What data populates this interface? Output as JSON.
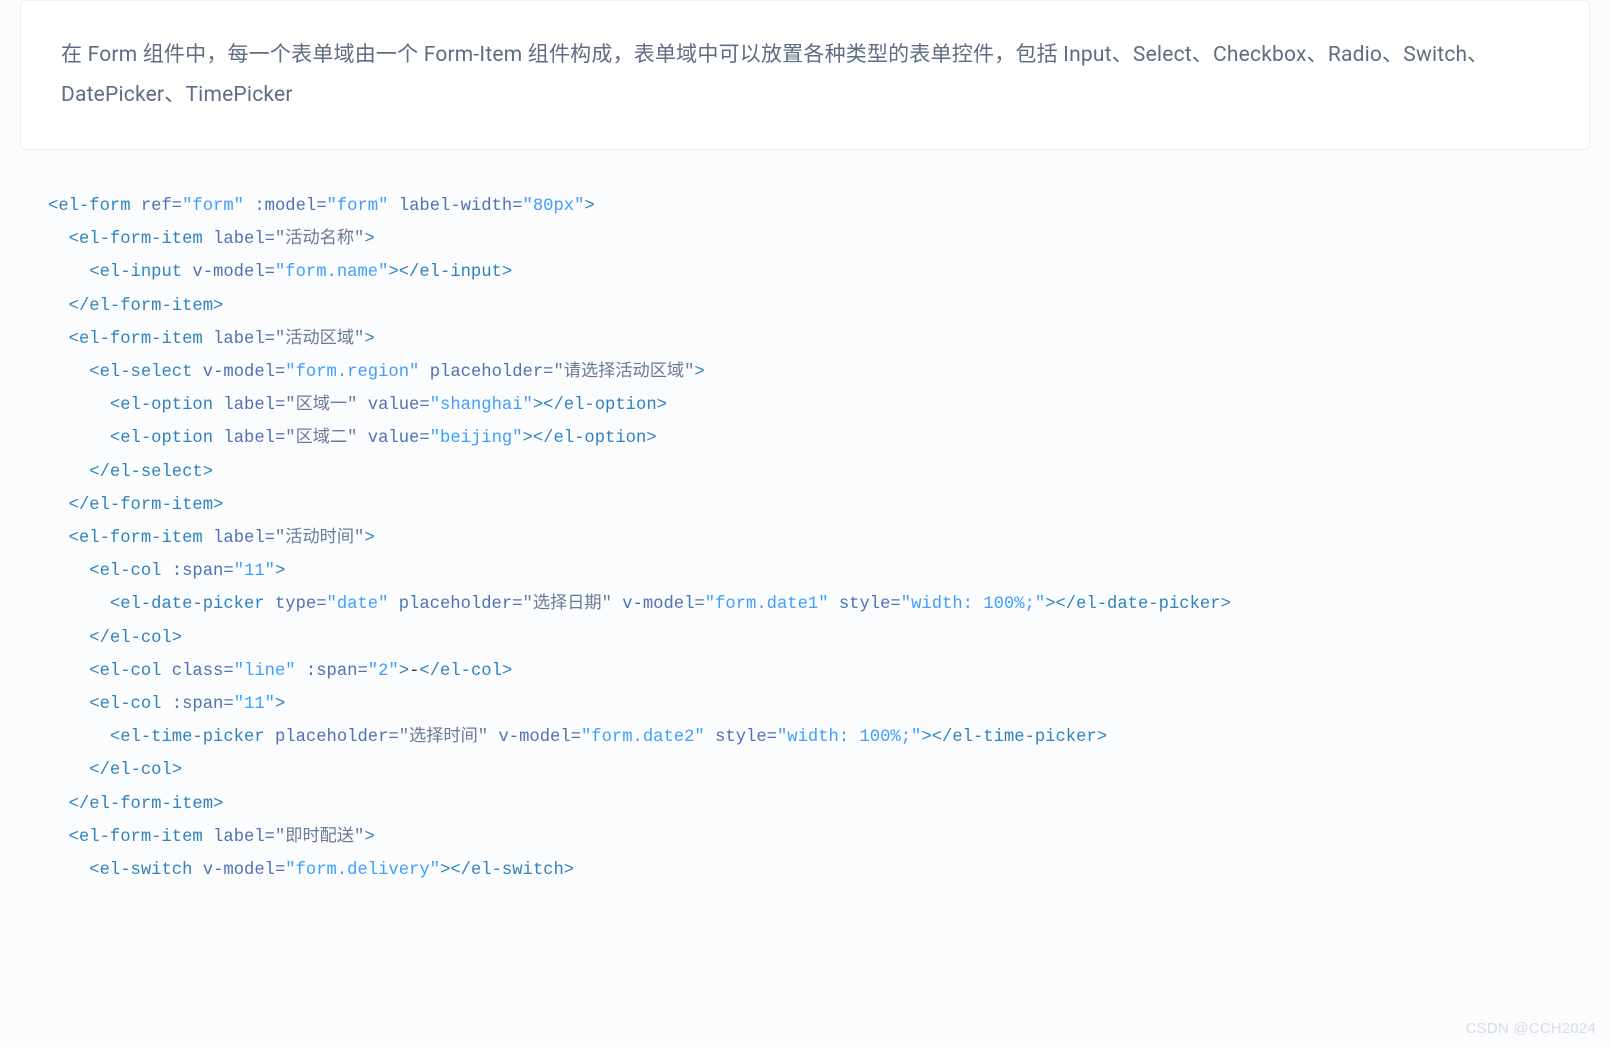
{
  "description": "在 Form 组件中，每一个表单域由一个 Form-Item 组件构成，表单域中可以放置各种类型的表单控件，包括 Input、Select、Checkbox、Radio、Switch、DatePicker、TimePicker",
  "code": {
    "l01": {
      "tag_open": "<el-form",
      "a1": "ref=",
      "v1": "\"form\"",
      "a2": ":model=",
      "v2": "\"form\"",
      "a3": "label-width=",
      "v3": "\"80px\"",
      "close": ">"
    },
    "l02": {
      "tag_open": "<el-form-item",
      "a1": "label=",
      "v1": "\"活动名称\"",
      "close": ">"
    },
    "l03": {
      "tag_open": "<el-input",
      "a1": "v-model=",
      "v1": "\"form.name\"",
      "mid": ">",
      "tag_close": "</el-input>"
    },
    "l04": {
      "tag_close": "</el-form-item>"
    },
    "l05": {
      "tag_open": "<el-form-item",
      "a1": "label=",
      "v1": "\"活动区域\"",
      "close": ">"
    },
    "l06": {
      "tag_open": "<el-select",
      "a1": "v-model=",
      "v1": "\"form.region\"",
      "a2": "placeholder=",
      "v2": "\"请选择活动区域\"",
      "close": ">"
    },
    "l07": {
      "tag_open": "<el-option",
      "a1": "label=",
      "v1": "\"区域一\"",
      "a2": "value=",
      "v2": "\"shanghai\"",
      "mid": ">",
      "tag_close": "</el-option>"
    },
    "l08": {
      "tag_open": "<el-option",
      "a1": "label=",
      "v1": "\"区域二\"",
      "a2": "value=",
      "v2": "\"beijing\"",
      "mid": ">",
      "tag_close": "</el-option>"
    },
    "l09": {
      "tag_close": "</el-select>"
    },
    "l10": {
      "tag_close": "</el-form-item>"
    },
    "l11": {
      "tag_open": "<el-form-item",
      "a1": "label=",
      "v1": "\"活动时间\"",
      "close": ">"
    },
    "l12": {
      "tag_open": "<el-col",
      "a1": ":span=",
      "v1": "\"11\"",
      "close": ">"
    },
    "l13": {
      "tag_open": "<el-date-picker",
      "a1": "type=",
      "v1": "\"date\"",
      "a2": "placeholder=",
      "v2": "\"选择日期\"",
      "a3": "v-model=",
      "v3": "\"form.date1\"",
      "a4": "style=",
      "v4": "\"width: 100%;\"",
      "mid": ">",
      "tag_close": "</el-date-picker>"
    },
    "l14": {
      "tag_close": "</el-col>"
    },
    "l15": {
      "tag_open": "<el-col",
      "a1": "class=",
      "v1": "\"line\"",
      "a2": ":span=",
      "v2": "\"2\"",
      "mid": ">",
      "text": "-",
      "tag_close": "</el-col>"
    },
    "l16": {
      "tag_open": "<el-col",
      "a1": ":span=",
      "v1": "\"11\"",
      "close": ">"
    },
    "l17": {
      "tag_open": "<el-time-picker",
      "a1": "placeholder=",
      "v1": "\"选择时间\"",
      "a2": "v-model=",
      "v2": "\"form.date2\"",
      "a3": "style=",
      "v3": "\"width: 100%;\"",
      "mid": ">",
      "tag_close": "</el-time-picker>"
    },
    "l18": {
      "tag_close": "</el-col>"
    },
    "l19": {
      "tag_close": "</el-form-item>"
    },
    "l20": {
      "tag_open": "<el-form-item",
      "a1": "label=",
      "v1": "\"即时配送\"",
      "close": ">"
    },
    "l21": {
      "tag_open": "<el-switch",
      "a1": "v-model=",
      "v1": "\"form.delivery\"",
      "mid": ">",
      "tag_close": "</el-switch>"
    }
  },
  "watermark": "CSDN @CCH2024"
}
